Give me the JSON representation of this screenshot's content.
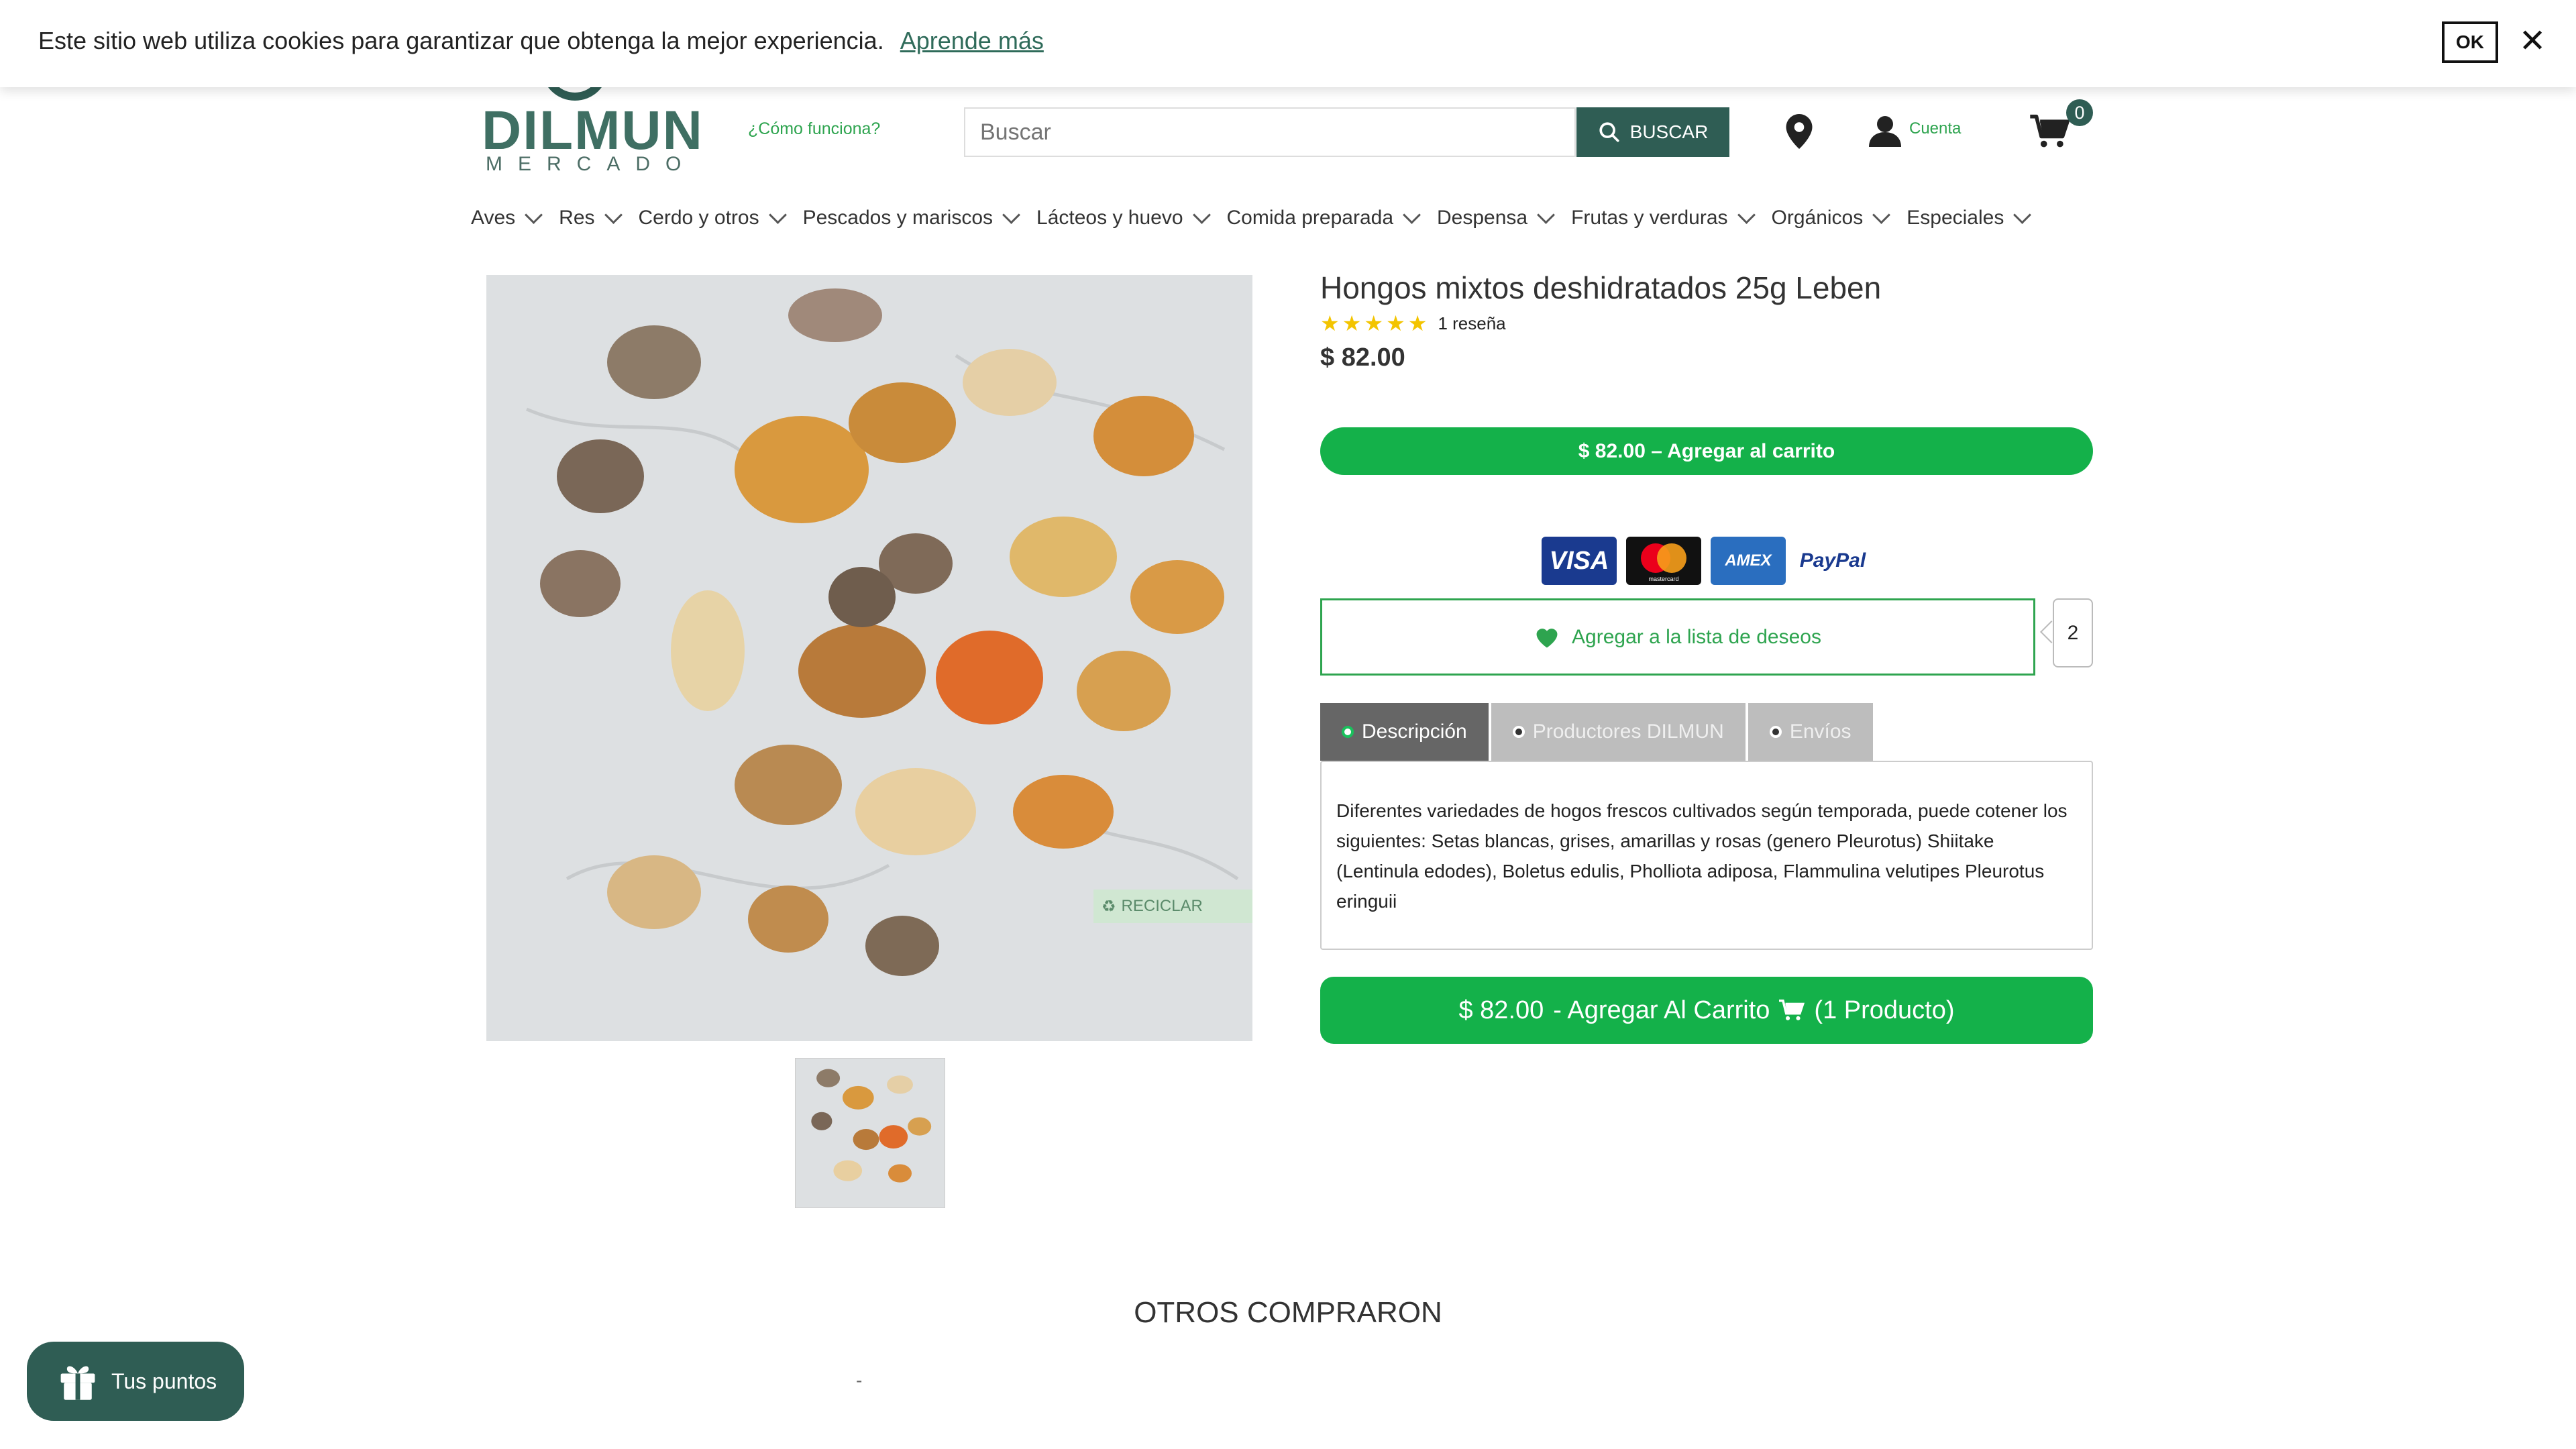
{
  "cookie_bar": {
    "message": "Este sitio web utiliza cookies para garantizar que obtenga la mejor experiencia.",
    "learn_more": "Aprende más",
    "ok": "OK",
    "close": "✕"
  },
  "header": {
    "logo_name": "DILMUN",
    "logo_sub": "MERCADO",
    "how_it_works": "¿Cómo funciona?",
    "search_placeholder": "Buscar",
    "search_button": "BUSCAR",
    "account": "Cuenta",
    "cart_count": "0"
  },
  "nav": {
    "items": [
      "Aves",
      "Res",
      "Cerdo y otros",
      "Pescados y mariscos",
      "Lácteos y huevo",
      "Comida preparada",
      "Despensa",
      "Frutas y verduras",
      "Orgánicos",
      "Especiales"
    ]
  },
  "product": {
    "title": "Hongos mixtos deshidratados 25g Leben",
    "rating": 5,
    "reviews": "1 reseña",
    "price": "$ 82.00",
    "recycle_label": "RECICLAR",
    "add_to_cart_top": "$ 82.00 – Agregar al carrito",
    "payment_methods": [
      "VISA",
      "mastercard",
      "AMEX",
      "PayPal"
    ],
    "wishlist_label": "Agregar a la lista de deseos",
    "wishlist_count": "2",
    "tabs": [
      "Descripción",
      "Productores DILMUN",
      "Envíos"
    ],
    "description": "Diferentes variedades de hogos frescos cultivados según temporada, puede cotener los siguientes: Setas blancas, grises, amarillas y rosas (genero Pleurotus) Shiitake (Lentinula edodes), Boletus edulis, Pholliota adiposa, Flammulina velutipes Pleurotus eringuii",
    "add_to_cart_bottom_price": "$ 82.00",
    "add_to_cart_bottom_label": "- Agregar Al Carrito",
    "add_to_cart_bottom_qty": "(1 Producto)"
  },
  "others": {
    "title": "OTROS COMPRARON",
    "dash": "-"
  },
  "points": {
    "label": "Tus puntos"
  },
  "colors": {
    "brand_green": "#2f5d54",
    "accent_green": "#14b14a",
    "link_green": "#2ea44f",
    "star": "#f3c400"
  }
}
